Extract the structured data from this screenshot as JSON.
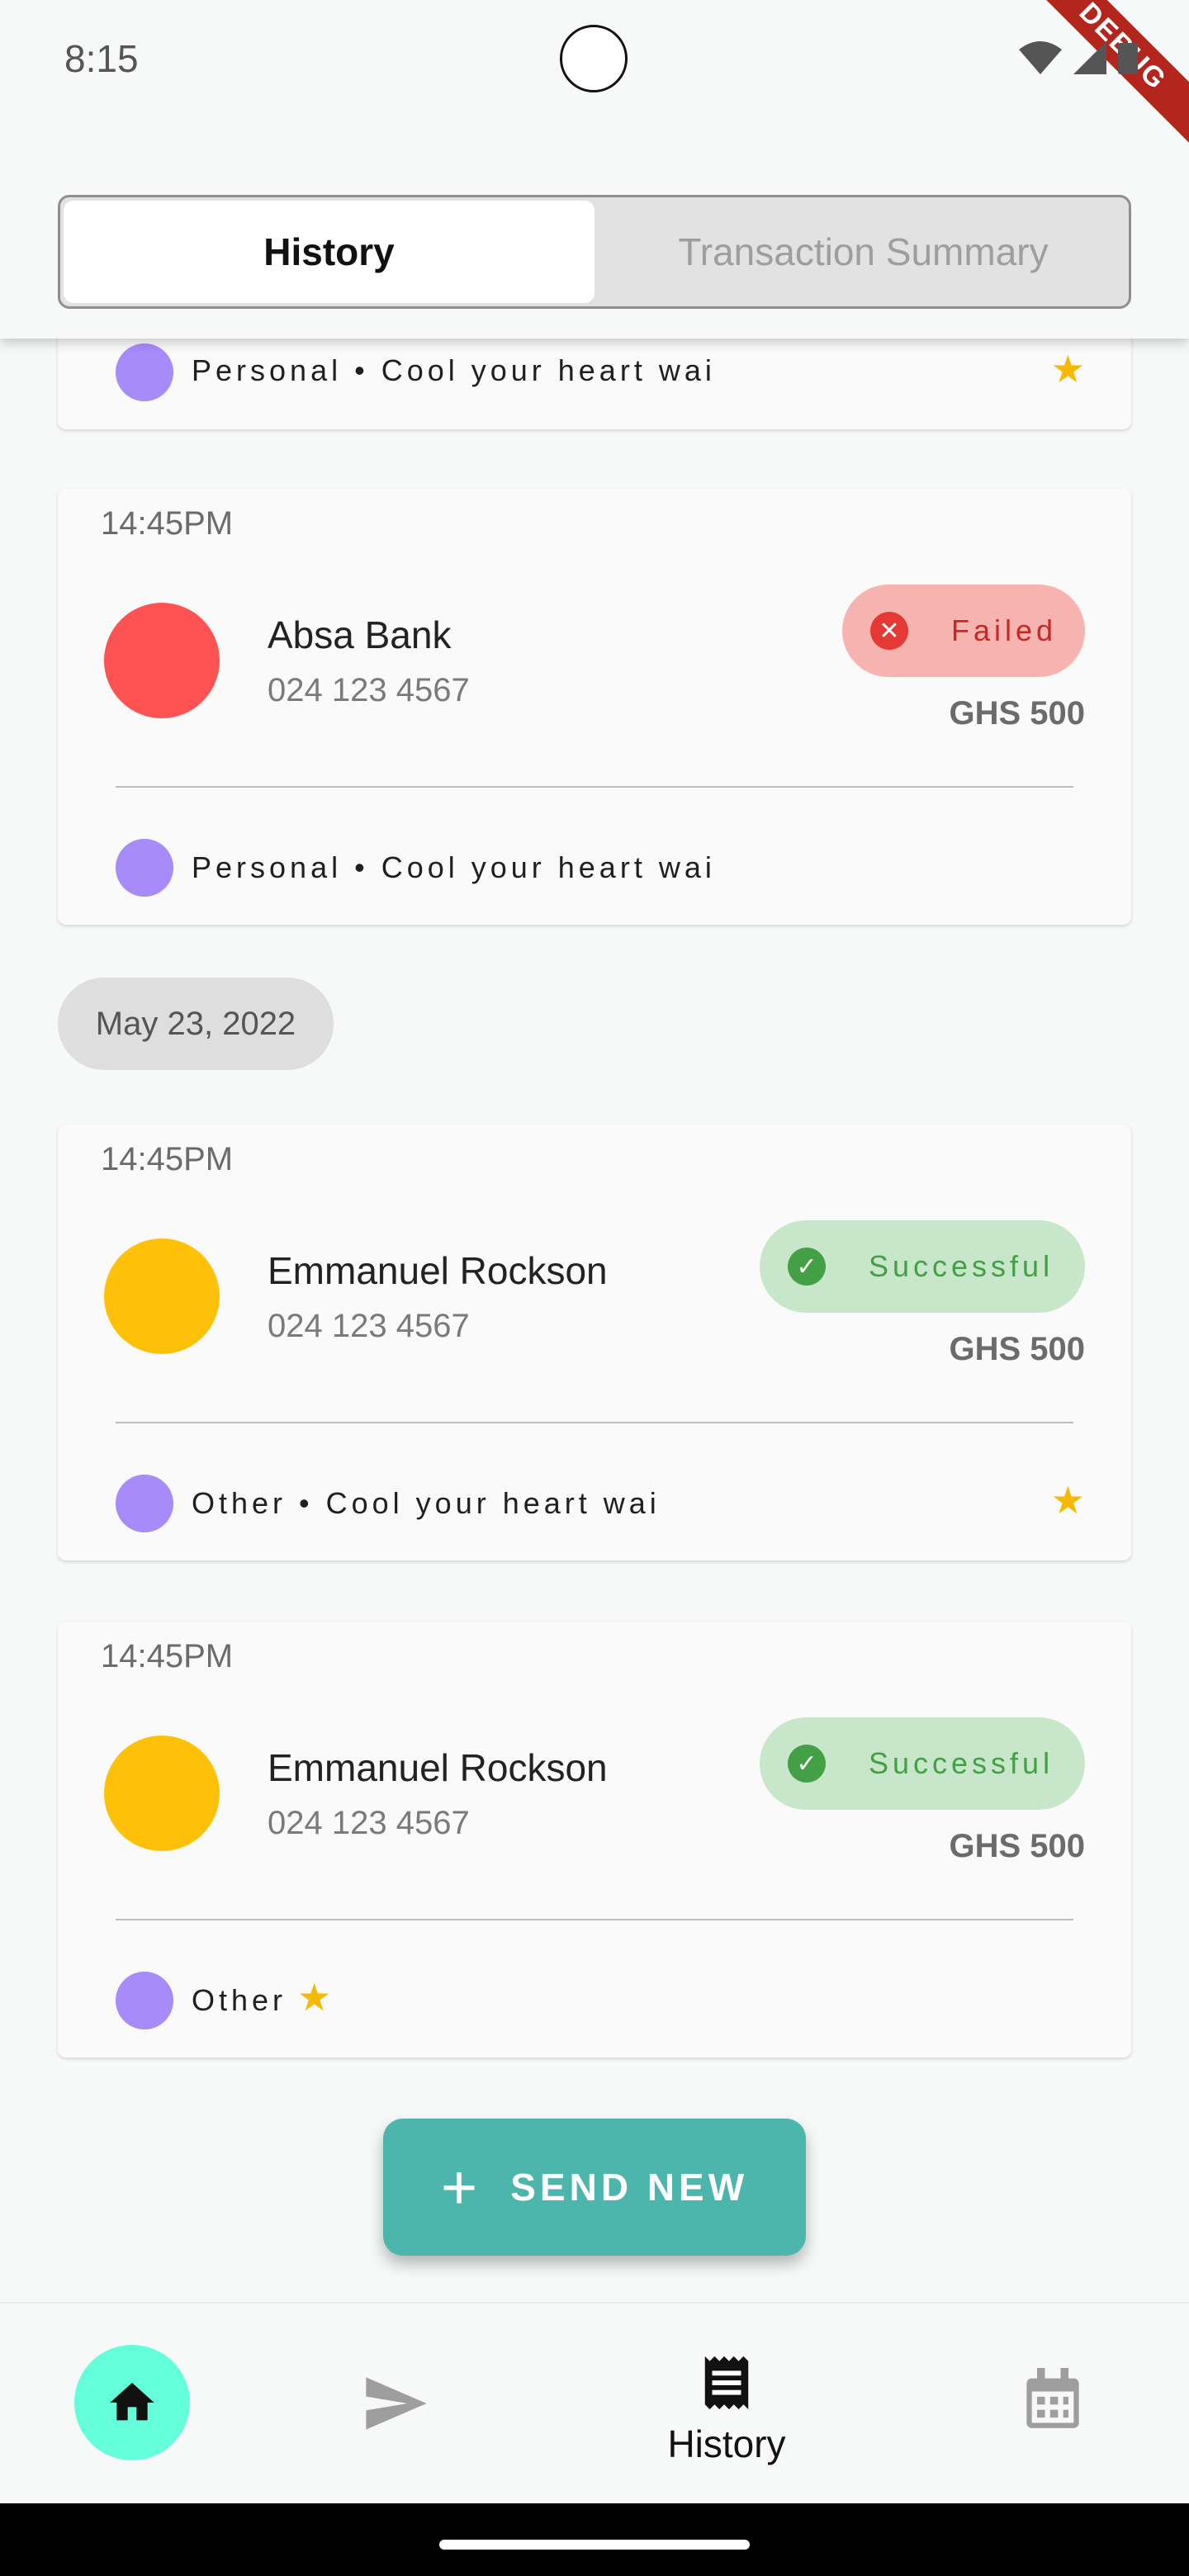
{
  "status_bar": {
    "time": "8:15",
    "debug_label": "DEBUG"
  },
  "tabs": [
    {
      "label": "History",
      "active": true
    },
    {
      "label": "Transaction Summary",
      "active": false
    }
  ],
  "partial_card": {
    "category": "Personal • Cool your heart wai",
    "starred": true
  },
  "transactions": [
    {
      "time": "14:45PM",
      "name": "Absa Bank",
      "phone": "024 123 4567",
      "status": "Failed",
      "amount": "GHS 500",
      "category": "Personal • Cool your heart wai",
      "starred": false,
      "avatar_color": "#ff5252"
    }
  ],
  "date_group": {
    "label": "May 23, 2022"
  },
  "grouped_transactions": [
    {
      "time": "14:45PM",
      "name": "Emmanuel Rockson",
      "phone": "024 123 4567",
      "status": "Successful",
      "amount": "GHS 500",
      "category": "Other • Cool your heart wai",
      "starred": true,
      "avatar_color": "#ffc107"
    },
    {
      "time": "14:45PM",
      "name": "Emmanuel Rockson",
      "phone": "024 123 4567",
      "status": "Successful",
      "amount": "GHS 500",
      "category": "Other",
      "starred": true,
      "avatar_color": "#ffc107"
    }
  ],
  "fab": {
    "label": "SEND NEW"
  },
  "bottom_nav": {
    "items": [
      {
        "icon": "home-icon",
        "selected_background": "#64ffda"
      },
      {
        "icon": "send-icon"
      },
      {
        "icon": "receipt-icon",
        "label": "History"
      },
      {
        "icon": "calendar-icon"
      }
    ]
  },
  "colors": {
    "accent": "#4db6ac",
    "failed": "#e53935",
    "success": "#43a047",
    "category_dot": "#a78bfa",
    "star": "#f6b800"
  }
}
